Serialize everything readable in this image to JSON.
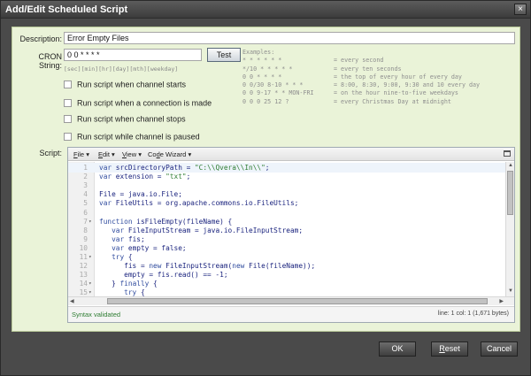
{
  "window": {
    "title": "Add/Edit Scheduled Script",
    "close_label": "×"
  },
  "description": {
    "label": "Description:",
    "value": "Error Empty Files"
  },
  "cron": {
    "label": "CRON String:",
    "value": "0 0 * * * *",
    "test_label": "Test",
    "hint": "[sec][min][hr][day][mth][weekday]"
  },
  "checkboxes": [
    {
      "label": "Run script when channel starts",
      "checked": false
    },
    {
      "label": "Run script when a connection is made",
      "checked": false
    },
    {
      "label": "Run script when channel stops",
      "checked": false
    },
    {
      "label": "Run script while channel is paused",
      "checked": false
    }
  ],
  "examples": {
    "heading": "Examples:",
    "rows": [
      {
        "expr": "* * * * * *",
        "desc": "= every second"
      },
      {
        "expr": "*/10 * * * * *",
        "desc": "= every ten seconds"
      },
      {
        "expr": "0 0 * * * *",
        "desc": "= the top of every hour of every day"
      },
      {
        "expr": "0 0/30 8-10 * * *",
        "desc": "= 8:00, 8:30, 9:00, 9:30 and 10 every day"
      },
      {
        "expr": "0 0 9-17 * * MON-FRI",
        "desc": "= on the hour nine-to-five weekdays"
      },
      {
        "expr": "0 0 0 25 12 ?",
        "desc": "= every Christmas Day at midnight"
      }
    ]
  },
  "script": {
    "label": "Script:",
    "menu": [
      {
        "pre": "",
        "u": "F",
        "post": "ile"
      },
      {
        "pre": "",
        "u": "E",
        "post": "dit"
      },
      {
        "pre": "",
        "u": "V",
        "post": "iew"
      },
      {
        "pre": "Co",
        "u": "d",
        "post": "e Wizard"
      }
    ],
    "lines": [
      {
        "n": "1",
        "fold": "",
        "code": "var srcDirectoryPath = \"C:\\\\Qvera\\\\In\\\\\";"
      },
      {
        "n": "2",
        "fold": "",
        "code": "var extension = \"txt\";"
      },
      {
        "n": "3",
        "fold": "",
        "code": ""
      },
      {
        "n": "4",
        "fold": "",
        "code": "File = java.io.File;"
      },
      {
        "n": "5",
        "fold": "",
        "code": "var FileUtils = org.apache.commons.io.FileUtils;"
      },
      {
        "n": "6",
        "fold": "",
        "code": ""
      },
      {
        "n": "7",
        "fold": "▾",
        "code": "function isFileEmpty(fileName) {"
      },
      {
        "n": "8",
        "fold": "",
        "code": "   var FileInputStream = java.io.FileInputStream;"
      },
      {
        "n": "9",
        "fold": "",
        "code": "   var fis;"
      },
      {
        "n": "10",
        "fold": "",
        "code": "   var empty = false;"
      },
      {
        "n": "11",
        "fold": "▾",
        "code": "   try {"
      },
      {
        "n": "12",
        "fold": "",
        "code": "      fis = new FileInputStream(new File(fileName));"
      },
      {
        "n": "13",
        "fold": "",
        "code": "      empty = fis.read() == -1;"
      },
      {
        "n": "14",
        "fold": "▾",
        "code": "   } finally {"
      },
      {
        "n": "15",
        "fold": "▾",
        "code": "      try {"
      }
    ],
    "status": "Syntax validated",
    "position": "line: 1  col: 1  (1,671 bytes)"
  },
  "footer": {
    "ok": "OK",
    "reset_u": "R",
    "reset_rest": "eset",
    "cancel": "Cancel"
  }
}
